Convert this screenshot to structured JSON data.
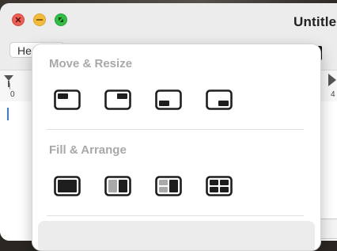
{
  "window": {
    "title": "Untitle"
  },
  "toolbar": {
    "font_value": "He"
  },
  "ruler": {
    "start": "0",
    "end": "4"
  },
  "menu": {
    "move_resize": {
      "heading": "Move & Resize",
      "options": [
        "top-left",
        "top-right",
        "bottom-left",
        "bottom-right"
      ]
    },
    "fill_arrange": {
      "heading": "Fill & Arrange",
      "options": [
        "fill",
        "left-and-right",
        "left-and-quarters",
        "quarters"
      ]
    }
  },
  "colors": {
    "close": "#ec5f57",
    "minimize": "#f3bb3c",
    "zoom": "#35bd46",
    "icon": "#1e1e1e"
  }
}
